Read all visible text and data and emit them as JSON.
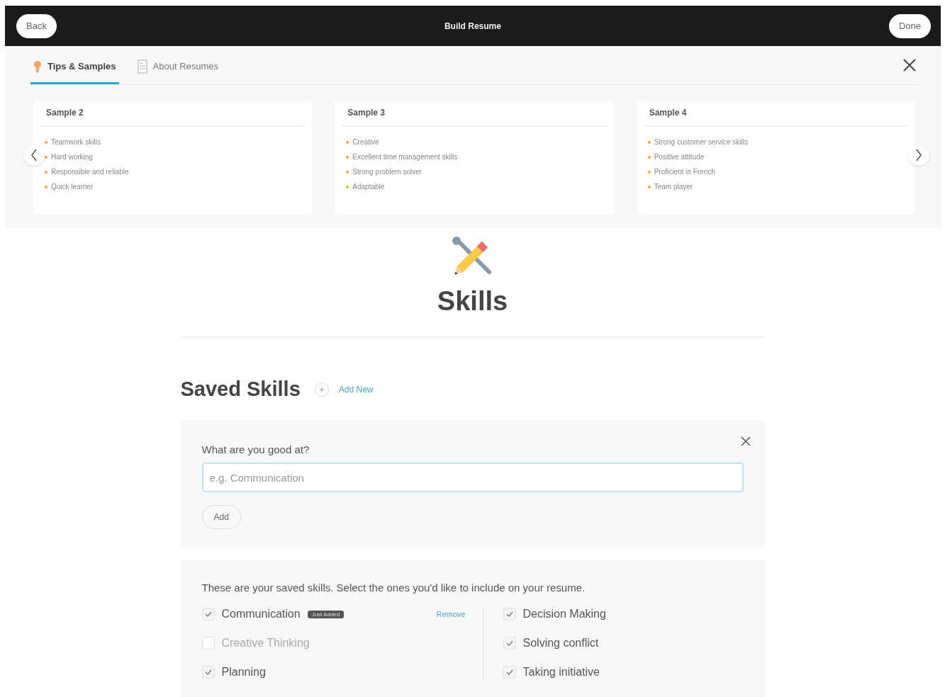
{
  "topbar": {
    "back": "Back",
    "title": "Build Resume",
    "done": "Done"
  },
  "tabs": [
    {
      "label": "Tips & Samples",
      "selected": true
    },
    {
      "label": "About Resumes",
      "selected": false
    }
  ],
  "samples": [
    {
      "title": "Sample 2",
      "items": [
        "Teamwork skills",
        "Hard working",
        "Responsible and reliable",
        "Quick learner"
      ]
    },
    {
      "title": "Sample 3",
      "items": [
        "Creative",
        "Excellent time management skills",
        "Strong problem solver",
        "Adaptable"
      ]
    },
    {
      "title": "Sample 4",
      "items": [
        "Strong customer service skills",
        "Positive attitude",
        "Proficient in French",
        "Team player"
      ]
    }
  ],
  "section": {
    "title": "Skills"
  },
  "saved": {
    "title": "Saved Skills",
    "add_new": "Add New"
  },
  "form": {
    "label": "What are you good at?",
    "placeholder": "e.g. Communication",
    "button": "Add"
  },
  "list": {
    "intro": "These are your saved skills. Select the ones you'd like to include on your resume.",
    "columns": [
      [
        {
          "name": "Communication",
          "checked": true,
          "badge": "Just Added",
          "action": "Remove"
        },
        {
          "name": "Creative Thinking",
          "checked": false
        },
        {
          "name": "Planning",
          "checked": true
        }
      ],
      [
        {
          "name": "Decision Making",
          "checked": true
        },
        {
          "name": "Solving conflict",
          "checked": true
        },
        {
          "name": "Taking initiative",
          "checked": true
        }
      ]
    ]
  }
}
